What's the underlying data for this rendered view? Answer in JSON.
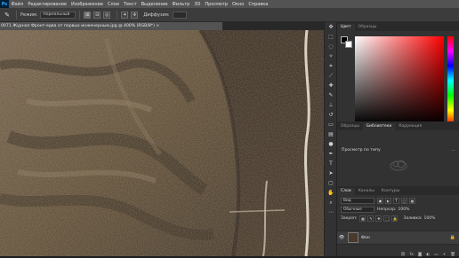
{
  "app": {
    "logo": "Ps",
    "menu": [
      "Файл",
      "Редактирование",
      "Изображение",
      "Слои",
      "Текст",
      "Выделение",
      "Фильтр",
      "3D",
      "Просмотр",
      "Окно",
      "Справка"
    ]
  },
  "options_bar": {
    "mode_label": "Режим:",
    "mode_value": "Нормальный",
    "dropdown_label": "Диффузия:",
    "icons": [
      "brush-tool-icon"
    ]
  },
  "document": {
    "tab_title": "0071 Журнал Фронт-едва от первых инженерным.jpg @ 400% (RGB/8*) ×"
  },
  "color_panel": {
    "tabs": [
      "Цвет",
      "Образцы"
    ],
    "foreground": "#000000",
    "background": "#ffffff"
  },
  "adjustments_panel": {
    "tabs": [
      "Образцы",
      "Библиотеки",
      "Коррекция"
    ],
    "active_tab": "Библиотеки",
    "preview_label": "Просмотр по типу",
    "menu_glyph": "⋯"
  },
  "layers_panel": {
    "tabs": [
      "Слои",
      "Каналы",
      "Контуры"
    ],
    "kind_placeholder": "Вид",
    "blend_mode": "Обычные",
    "opacity_label": "Непрозр:",
    "opacity_value": "100%",
    "lock_label": "Закреп:",
    "fill_label": "Заливка:",
    "fill_value": "100%",
    "layer_name": "Фон"
  },
  "colors": {
    "menubar": "#535353",
    "panel": "#323232",
    "accent_hue_top": "#ff0000"
  }
}
